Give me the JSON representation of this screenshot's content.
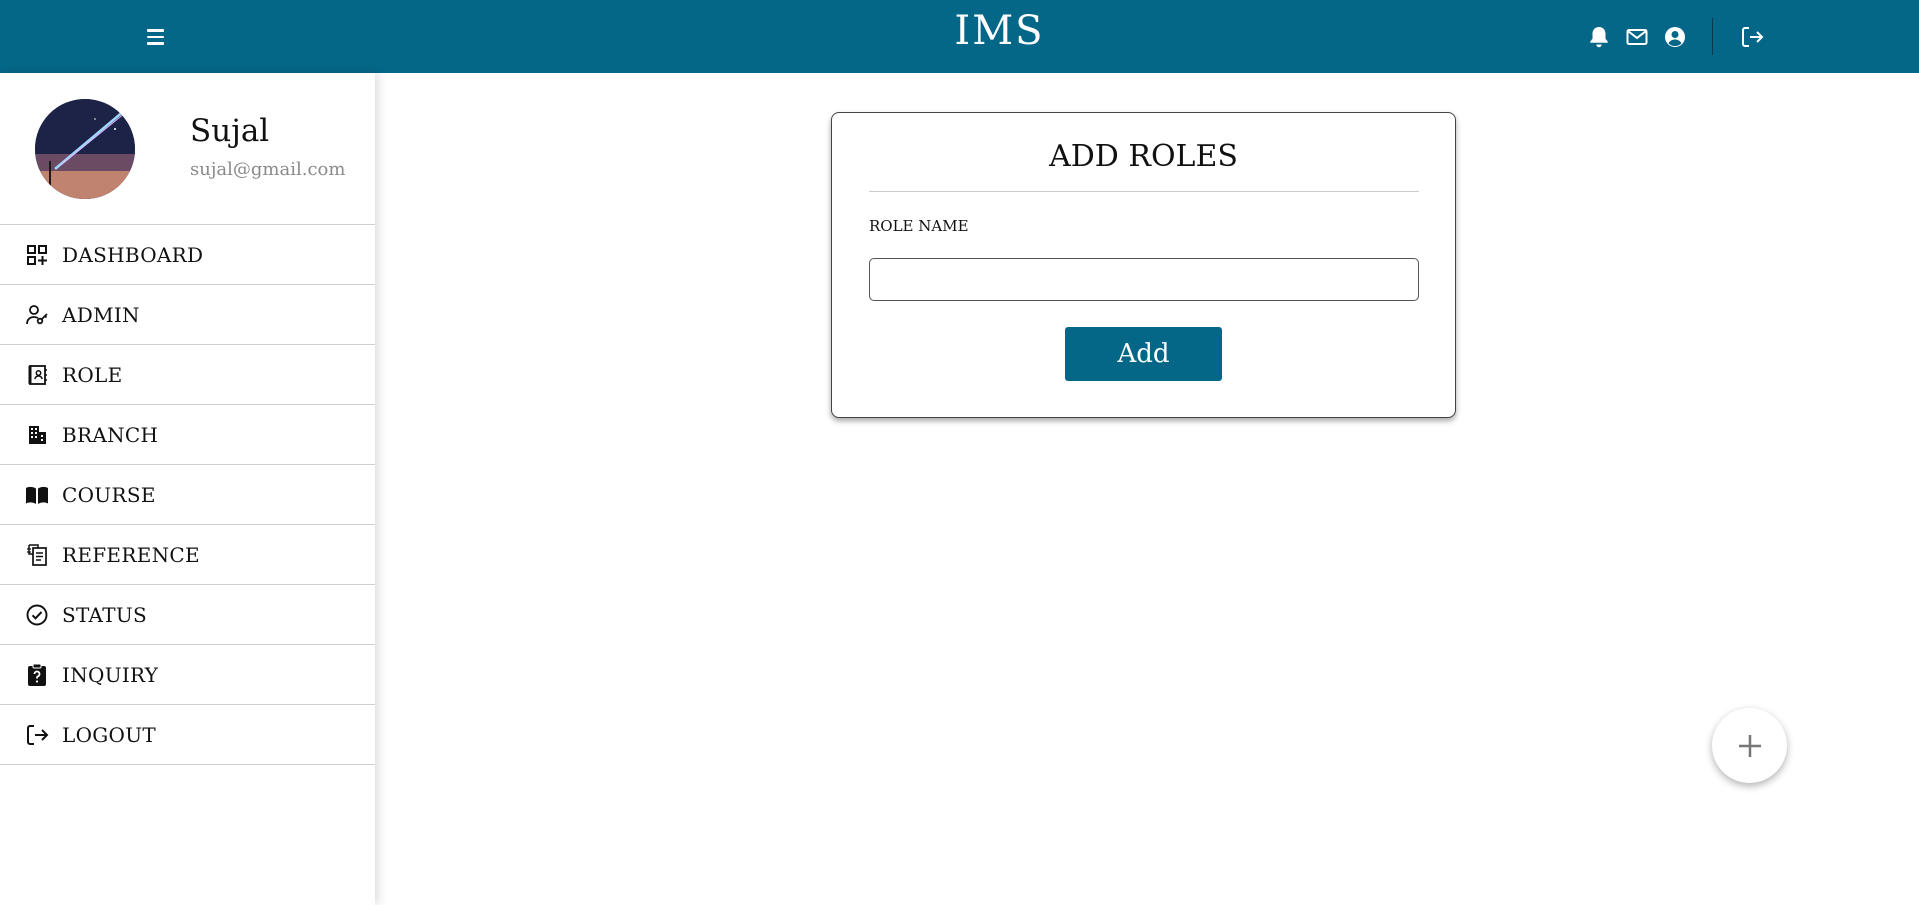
{
  "header": {
    "title": "IMS",
    "menu_icon": "hamburger-menu-icon",
    "icons": [
      "bell-icon",
      "mail-icon",
      "user-circle-icon",
      "logout-icon"
    ],
    "background_color": "#056787"
  },
  "profile": {
    "name": "Sujal",
    "email": "sujal@gmail.com"
  },
  "sidebar": {
    "items": [
      {
        "label": "DASHBOARD",
        "icon": "dashboard-grid-icon"
      },
      {
        "label": "ADMIN",
        "icon": "user-key-icon"
      },
      {
        "label": "ROLE",
        "icon": "contact-book-icon"
      },
      {
        "label": "BRANCH",
        "icon": "building-icon"
      },
      {
        "label": "COURSE",
        "icon": "open-book-icon"
      },
      {
        "label": "REFERENCE",
        "icon": "document-reference-icon"
      },
      {
        "label": "STATUS",
        "icon": "check-circle-icon"
      },
      {
        "label": "INQUIRY",
        "icon": "clipboard-question-icon"
      },
      {
        "label": "LOGOUT",
        "icon": "logout-icon"
      }
    ]
  },
  "form": {
    "title": "ADD ROLES",
    "field_label": "ROLE NAME",
    "field_value": "",
    "submit_label": "Add",
    "accent_color": "#056787"
  },
  "fab": {
    "icon": "plus-icon"
  }
}
